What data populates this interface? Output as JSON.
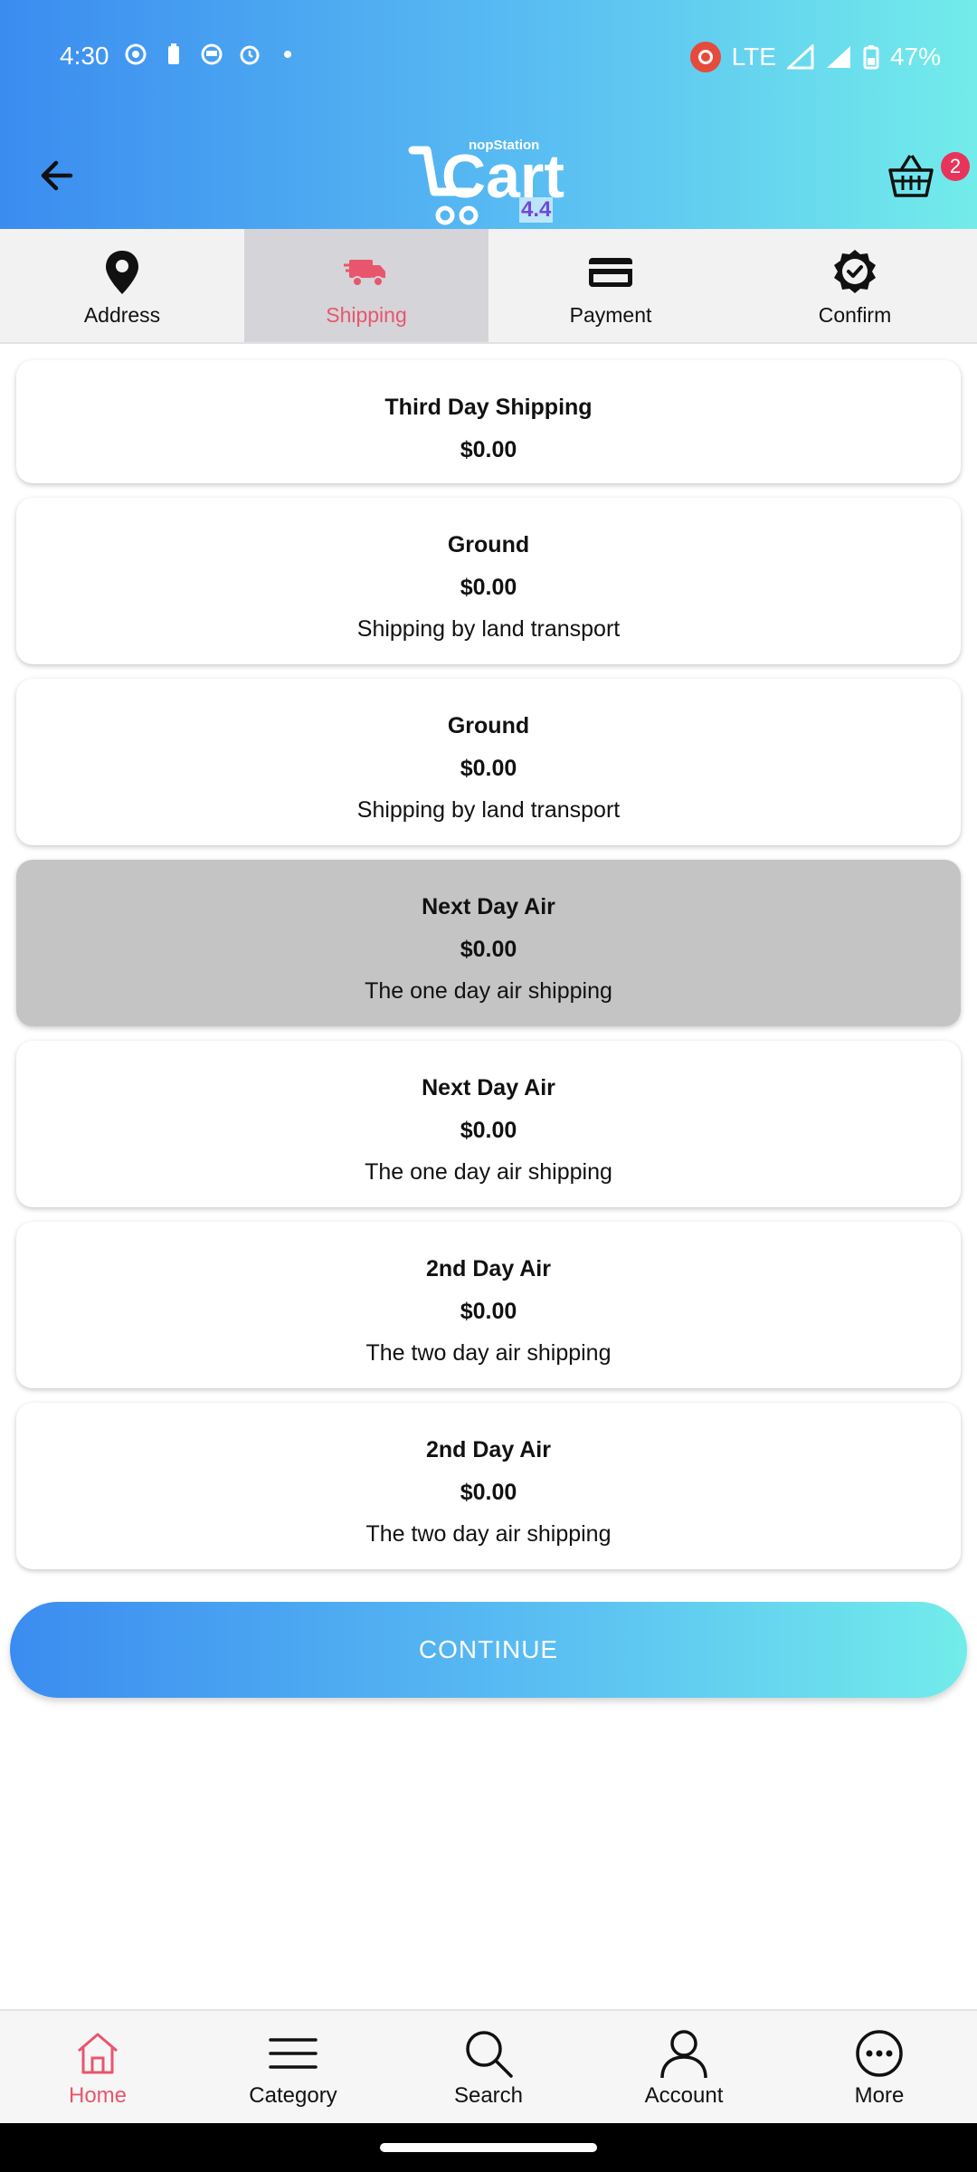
{
  "status_bar": {
    "time": "4:30",
    "network": "LTE",
    "battery": "47%"
  },
  "header": {
    "logo_small_text": "nopStation",
    "logo_text": "Cart",
    "logo_version": "4.4",
    "cart_count": "2"
  },
  "steps": [
    {
      "label": "Address",
      "icon": "map-pin-icon",
      "active": false
    },
    {
      "label": "Shipping",
      "icon": "truck-icon",
      "active": true
    },
    {
      "label": "Payment",
      "icon": "credit-card-icon",
      "active": false
    },
    {
      "label": "Confirm",
      "icon": "check-badge-icon",
      "active": false
    }
  ],
  "shipping_options": [
    {
      "name": "Third Day Shipping",
      "price": "$0.00",
      "description": ""
    },
    {
      "name": "Ground",
      "price": "$0.00",
      "description": "Shipping by land transport"
    },
    {
      "name": "Ground",
      "price": "$0.00",
      "description": "Shipping by land transport"
    },
    {
      "name": "Next Day Air",
      "price": "$0.00",
      "description": "The one day air shipping",
      "selected": true
    },
    {
      "name": "Next Day Air",
      "price": "$0.00",
      "description": "The one day air shipping"
    },
    {
      "name": "2nd Day Air",
      "price": "$0.00",
      "description": "The two day air shipping"
    },
    {
      "name": "2nd Day Air",
      "price": "$0.00",
      "description": "The two day air shipping"
    }
  ],
  "continue_label": "CONTINUE",
  "bottom_nav": [
    {
      "label": "Home",
      "icon": "home-icon",
      "active": true
    },
    {
      "label": "Category",
      "icon": "menu-icon",
      "active": false
    },
    {
      "label": "Search",
      "icon": "search-icon",
      "active": false
    },
    {
      "label": "Account",
      "icon": "user-icon",
      "active": false
    },
    {
      "label": "More",
      "icon": "more-icon",
      "active": false
    }
  ],
  "colors": {
    "accent": "#e8566d",
    "gradient_start": "#3b8cf0",
    "gradient_end": "#72ecea",
    "selected_card": "#c4c4c4"
  }
}
